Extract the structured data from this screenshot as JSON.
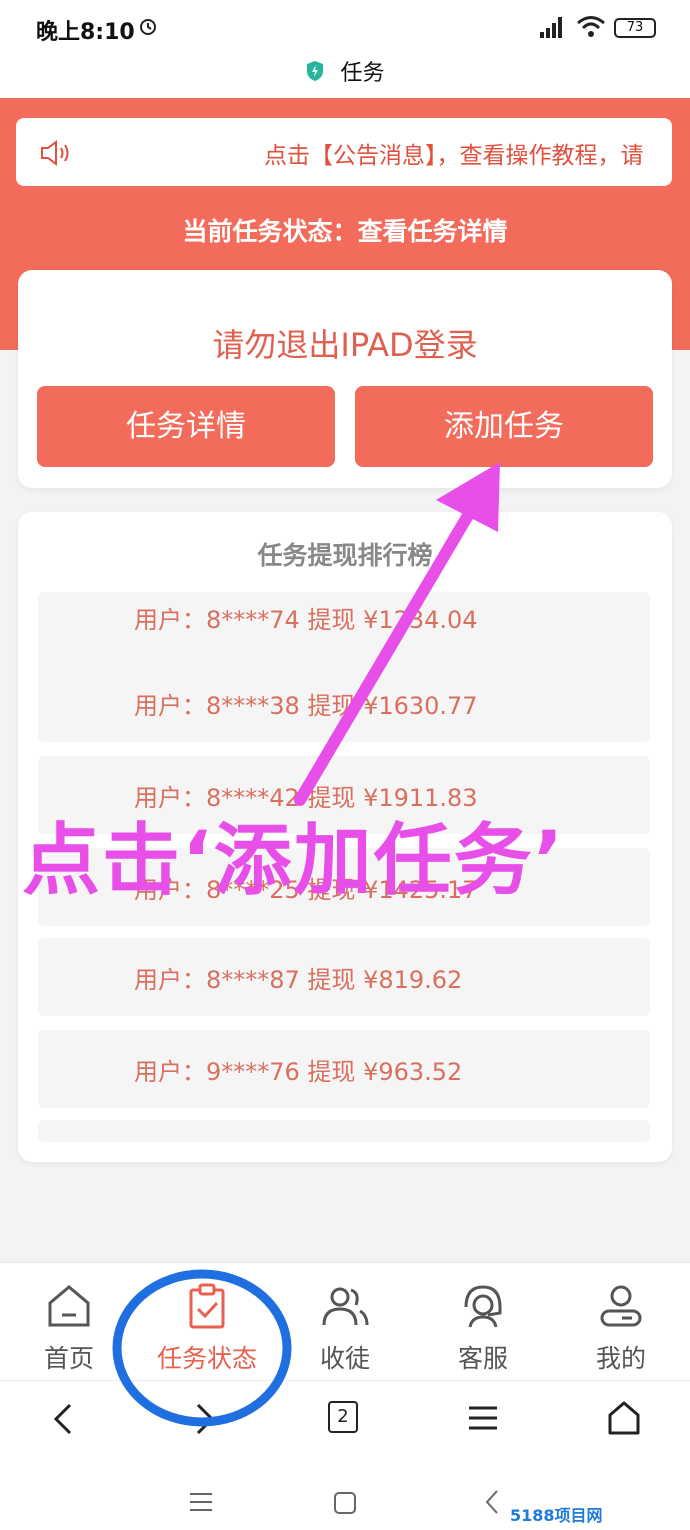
{
  "status_bar": {
    "time": "晚上8:10",
    "battery": "73"
  },
  "title_bar": {
    "title": "任务"
  },
  "notice": {
    "text": "点击【公告消息】，查看操作教程，请"
  },
  "task_status_line": "当前任务状态：查看任务详情",
  "action_card": {
    "warning": "请勿退出IPAD登录",
    "detail_button": "任务详情",
    "add_button": "添加任务"
  },
  "ranking": {
    "title": "任务提现排行榜",
    "rows": [
      "用户：8****74 提现 ¥1234.04",
      "用户：8****38 提现 ¥1630.77",
      "用户：8****42 提现 ¥1911.83",
      "用户：8****25 提现 ¥1425.17",
      "用户：8****87 提现 ¥819.62",
      "用户：9****76 提现 ¥963.52"
    ]
  },
  "annotation": {
    "text": "点击‘添加任务’"
  },
  "bottom_nav": [
    {
      "label": "首页",
      "icon": "home-icon"
    },
    {
      "label": "任务状态",
      "icon": "clipboard-check-icon",
      "active": true
    },
    {
      "label": "收徒",
      "icon": "users-icon"
    },
    {
      "label": "客服",
      "icon": "headset-icon"
    },
    {
      "label": "我的",
      "icon": "user-icon"
    }
  ],
  "browser_bar": {
    "tabs_count": "2"
  },
  "watermark": "5188项目网",
  "colors": {
    "accent": "#f36b5b",
    "annotation": "#e84ee8",
    "circle": "#1f6fe0"
  }
}
